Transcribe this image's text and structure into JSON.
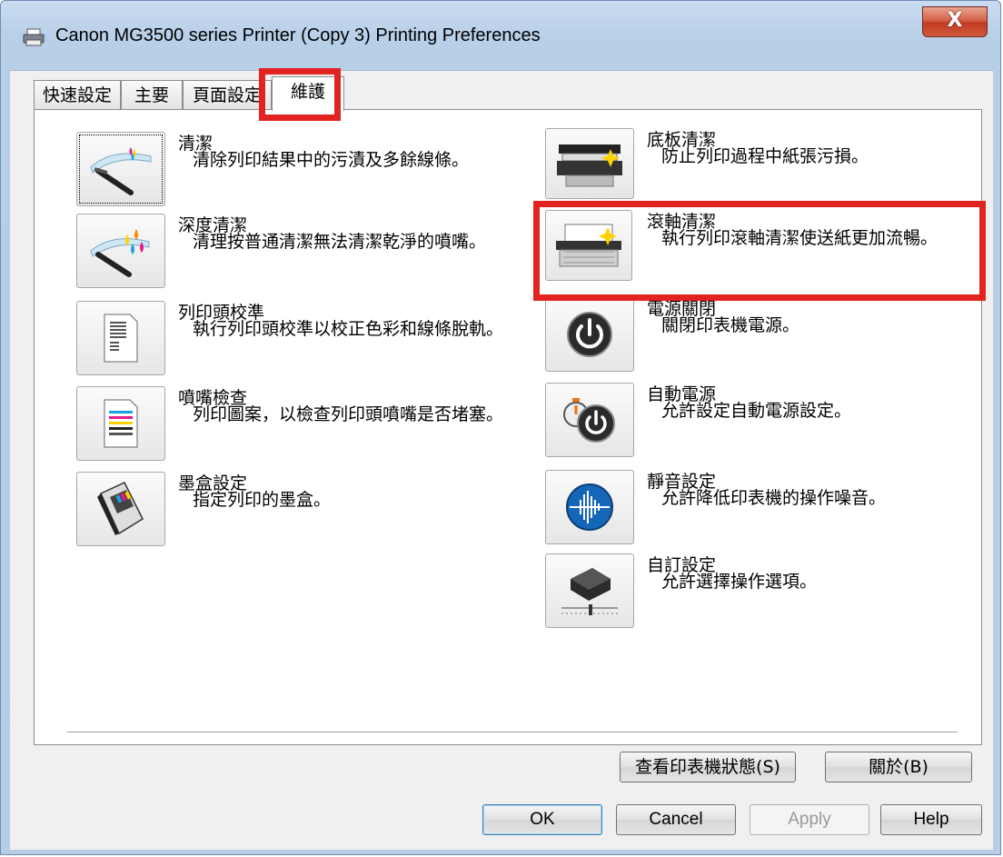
{
  "window": {
    "title": "Canon MG3500 series Printer (Copy 3) Printing Preferences",
    "close_label": "X"
  },
  "tabs": [
    {
      "label": "快速設定"
    },
    {
      "label": "主要"
    },
    {
      "label": "頁面設定"
    },
    {
      "label": "維護",
      "active": true
    }
  ],
  "left_items": [
    {
      "title": "清潔",
      "desc": "清除列印結果中的污漬及多餘線條。"
    },
    {
      "title": "深度清潔",
      "desc": "清理按普通清潔無法清潔乾淨的噴嘴。"
    },
    {
      "title": "列印頭校準",
      "desc": "執行列印頭校準以校正色彩和線條脫軌。"
    },
    {
      "title": "噴嘴檢查",
      "desc": "列印圖案，以檢查列印頭噴嘴是否堵塞。"
    },
    {
      "title": "墨盒設定",
      "desc": "指定列印的墨盒。"
    }
  ],
  "right_items": [
    {
      "title": "底板清潔",
      "desc": "防止列印過程中紙張污損。"
    },
    {
      "title": "滾軸清潔",
      "desc": "執行列印滾軸清潔使送紙更加流暢。"
    },
    {
      "title": "電源關閉",
      "desc": "關閉印表機電源。"
    },
    {
      "title": "自動電源",
      "desc": "允許設定自動電源設定。"
    },
    {
      "title": "靜音設定",
      "desc": "允許降低印表機的操作噪音。"
    },
    {
      "title": "自訂設定",
      "desc": "允許選擇操作選項。"
    }
  ],
  "panel_buttons": {
    "view_status": "查看印表機狀態(S)",
    "about": "關於(B)"
  },
  "dialog_buttons": {
    "ok": "OK",
    "cancel": "Cancel",
    "apply": "Apply",
    "help": "Help"
  },
  "colors": {
    "highlight": "#e2231f",
    "title_bar": "#b8cfe8",
    "close_button": "#c23a22"
  }
}
